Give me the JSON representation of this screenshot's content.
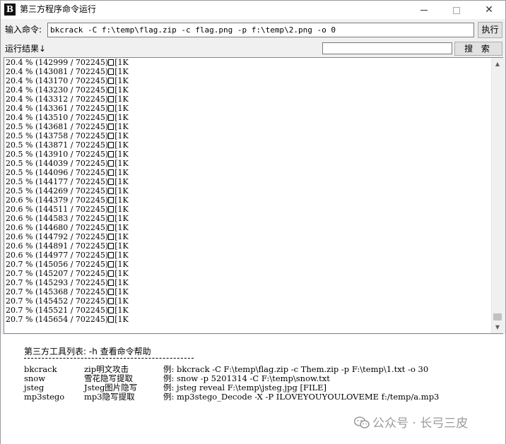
{
  "window": {
    "title": "第三方程序命令运行",
    "icon_text": "B"
  },
  "command": {
    "label": "输入命令:",
    "value": "bkcrack -C f:\\temp\\flag.zip -c flag.png -p f:\\temp\\2.png -o 0",
    "run_label": "执行"
  },
  "results": {
    "label": "运行结果↓",
    "search_value": "",
    "search_label": "搜 索"
  },
  "output_lines": [
    {
      "pct": "20.4",
      "cur": "142999"
    },
    {
      "pct": "20.4",
      "cur": "143081"
    },
    {
      "pct": "20.4",
      "cur": "143170"
    },
    {
      "pct": "20.4",
      "cur": "143230"
    },
    {
      "pct": "20.4",
      "cur": "143312"
    },
    {
      "pct": "20.4",
      "cur": "143361"
    },
    {
      "pct": "20.4",
      "cur": "143510"
    },
    {
      "pct": "20.5",
      "cur": "143681"
    },
    {
      "pct": "20.5",
      "cur": "143758"
    },
    {
      "pct": "20.5",
      "cur": "143871"
    },
    {
      "pct": "20.5",
      "cur": "143910"
    },
    {
      "pct": "20.5",
      "cur": "144039"
    },
    {
      "pct": "20.5",
      "cur": "144096"
    },
    {
      "pct": "20.5",
      "cur": "144177"
    },
    {
      "pct": "20.5",
      "cur": "144269"
    },
    {
      "pct": "20.6",
      "cur": "144379"
    },
    {
      "pct": "20.6",
      "cur": "144511"
    },
    {
      "pct": "20.6",
      "cur": "144583"
    },
    {
      "pct": "20.6",
      "cur": "144680"
    },
    {
      "pct": "20.6",
      "cur": "144792"
    },
    {
      "pct": "20.6",
      "cur": "144891"
    },
    {
      "pct": "20.6",
      "cur": "144977"
    },
    {
      "pct": "20.7",
      "cur": "145056"
    },
    {
      "pct": "20.7",
      "cur": "145207"
    },
    {
      "pct": "20.7",
      "cur": "145293"
    },
    {
      "pct": "20.7",
      "cur": "145368"
    },
    {
      "pct": "20.7",
      "cur": "145452"
    },
    {
      "pct": "20.7",
      "cur": "145521"
    },
    {
      "pct": "20.7",
      "cur": "145654"
    }
  ],
  "output_total": "702245",
  "output_suffix": "[1K",
  "tools": {
    "title": "第三方工具列表: -h 查看命令帮助",
    "rows": [
      {
        "name": "bkcrack",
        "desc": "zip明文攻击",
        "example": "例: bkcrack -C F:\\temp\\flag.zip -c Them.zip -p F:\\temp\\1.txt -o 30"
      },
      {
        "name": "snow",
        "desc": "雪花隐写提取",
        "example": "例: snow -p 5201314 -C F:\\temp\\snow.txt"
      },
      {
        "name": "jsteg",
        "desc": "Jsteg图片隐写",
        "example": "例: jsteg reveal F:\\temp\\jsteg.jpg [FILE]"
      },
      {
        "name": "mp3stego",
        "desc": "mp3隐写提取",
        "example": "例: mp3stego_Decode -X -P ILOVEYOUYOULOVEME f:/temp/a.mp3"
      }
    ]
  },
  "watermark": "公众号 · 长弓三皮",
  "colors": {
    "window_bg": "#f0f0f0",
    "button_bg": "#e1e1e1",
    "text": "#000000"
  }
}
